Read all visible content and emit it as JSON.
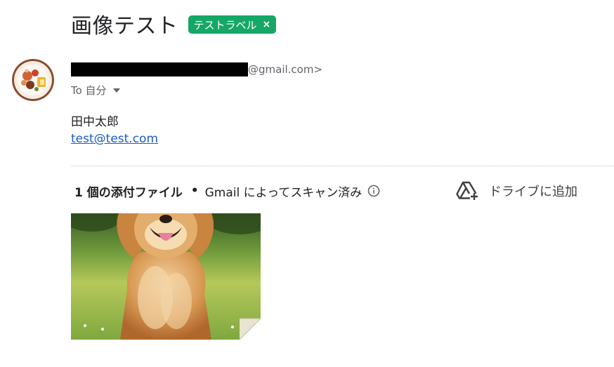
{
  "email": {
    "subject": "画像テスト",
    "label": "テストラベル",
    "label_remove": "×",
    "sender_domain_suffix": "@gmail.com>",
    "to_line": "To 自分",
    "body": {
      "name": "田中太郎",
      "email_link": "test@test.com"
    }
  },
  "attachments": {
    "count_text": "1 個の添付ファイル",
    "separator": "•",
    "scan_text": "Gmail によってスキャン済み",
    "add_to_drive": "ドライブに追加",
    "items": [
      {
        "type": "image",
        "description": "golden retriever photo"
      }
    ]
  },
  "colors": {
    "label_bg": "#16a765",
    "link": "#1a5cc8"
  },
  "icons": [
    "info-icon",
    "add-to-drive-icon",
    "chevron-down-icon",
    "close-icon"
  ]
}
